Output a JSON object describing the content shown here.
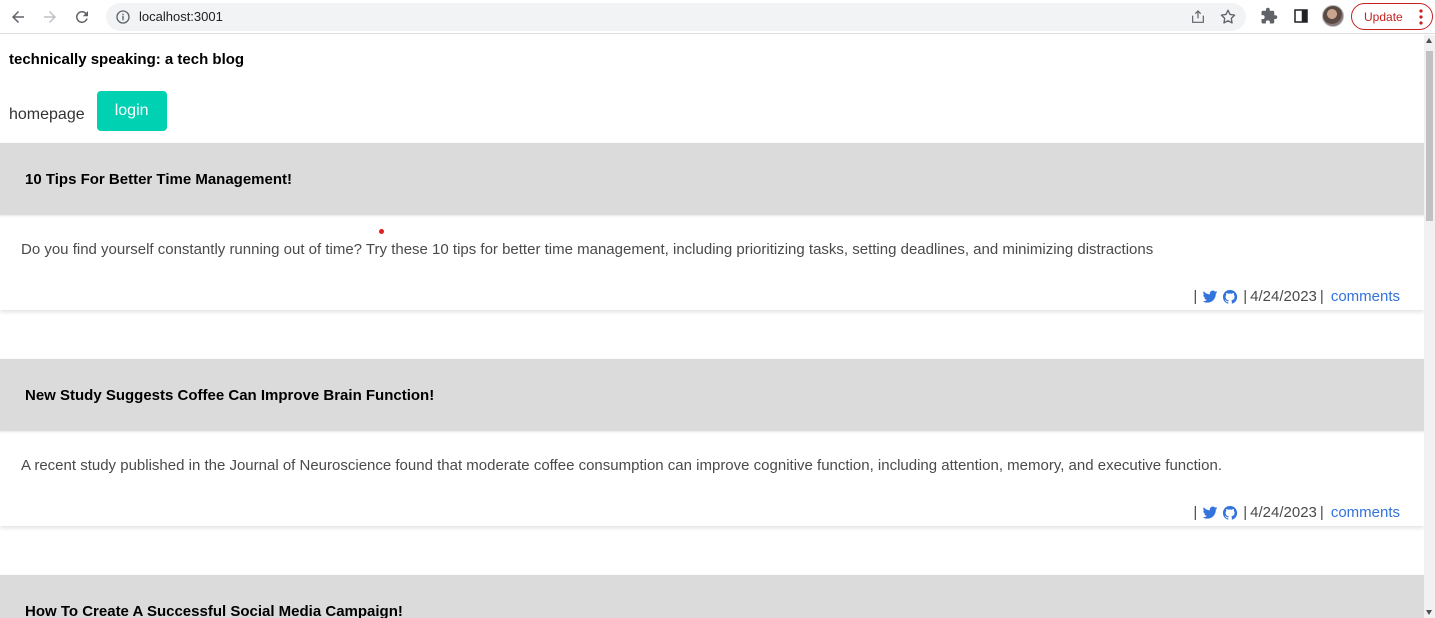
{
  "browser": {
    "url": "localhost:3001",
    "update_label": "Update"
  },
  "site": {
    "title": "technically speaking: a tech blog",
    "nav": {
      "home_label": "homepage",
      "login_label": "login"
    }
  },
  "posts": [
    {
      "title": "10 Tips For Better Time Management!",
      "body": "Do you find yourself constantly running out of time? Try these 10 tips for better time management, including prioritizing tasks, setting deadlines, and minimizing distractions",
      "date": "4/24/2023",
      "comments_label": "comments"
    },
    {
      "title": "New Study Suggests Coffee Can Improve Brain Function!",
      "body": "A recent study published in the Journal of Neuroscience found that moderate coffee consumption can improve cognitive function, including attention, memory, and executive function.",
      "date": "4/24/2023",
      "comments_label": "comments"
    },
    {
      "title": "How To Create A Successful Social Media Campaign!"
    }
  ],
  "icons": {
    "twitter": "twitter-icon",
    "github": "github-icon"
  },
  "colors": {
    "accent": "#00d1b2",
    "link": "#3273dc",
    "card_header": "#dbdbdb",
    "update": "#c5221f"
  }
}
